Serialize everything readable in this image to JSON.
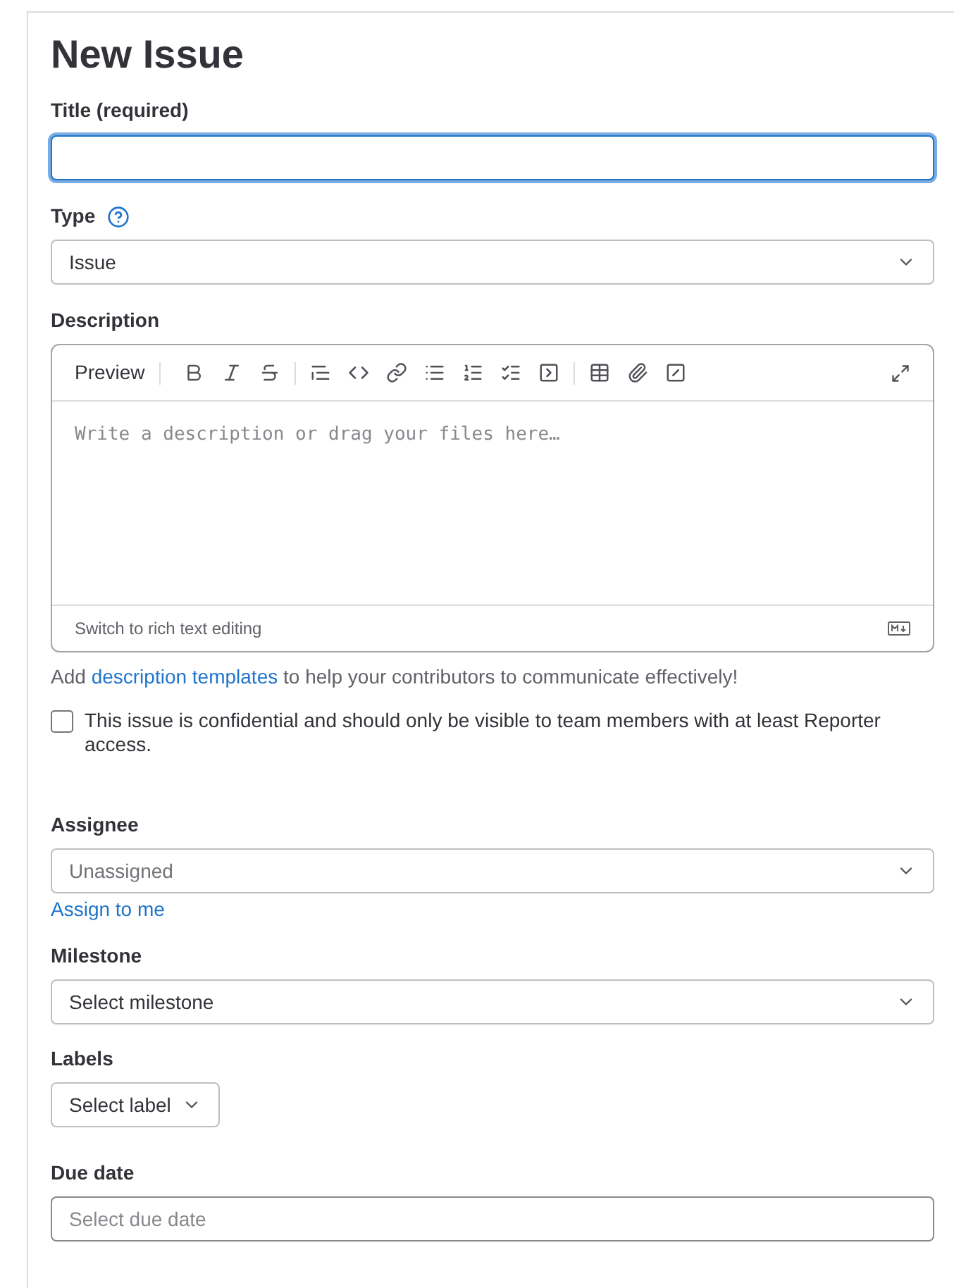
{
  "page_title": "New Issue",
  "title_field": {
    "label": "Title (required)",
    "focused": true
  },
  "type_field": {
    "label": "Type",
    "value": "Issue"
  },
  "description": {
    "label": "Description",
    "preview_tab": "Preview",
    "placeholder": "Write a description or drag your files here…",
    "footer": "Switch to rich text editing"
  },
  "templates_hint_parts": [
    "Add ",
    "description templates",
    " to help your contributors to communicate effectively!"
  ],
  "confidential": {
    "label": "This issue is confidential and should only be visible to team members with at least Reporter access.",
    "checked": false
  },
  "assignee": {
    "label": "Assignee",
    "value": "Unassigned",
    "link": "Assign to me"
  },
  "milestone": {
    "label": "Milestone",
    "value": "Select milestone"
  },
  "labels": {
    "label": "Labels",
    "button": "Select label"
  },
  "due_date": {
    "label": "Due date",
    "placeholder": "Select due date"
  }
}
